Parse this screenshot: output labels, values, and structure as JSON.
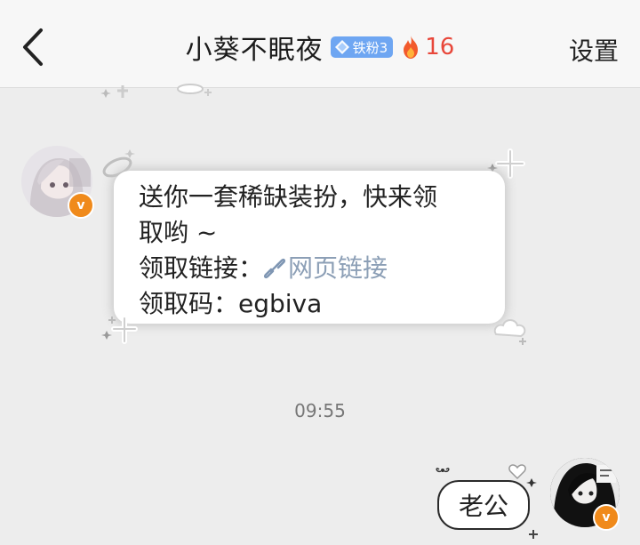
{
  "header": {
    "title": "小葵不眠夜",
    "fan_badge": "铁粉3",
    "fire_count": "16",
    "settings_label": "设置"
  },
  "messages": {
    "incoming": {
      "line1": "送你一套稀缺装扮，快来领",
      "line2": "取哟 ~",
      "link_prefix": "领取链接：",
      "link_text": "网页链接",
      "code_line": "领取码：egbiva"
    },
    "timestamp": "09:55",
    "outgoing": {
      "text": "老公"
    }
  },
  "icons": {
    "back": "chevron-left-icon",
    "badge_diamond": "diamond-icon",
    "fire": "fire-icon",
    "link": "link-icon",
    "verified": "verified-v-icon"
  },
  "colors": {
    "background": "#ededed",
    "badge_blue": "#6ea6f2",
    "fire_red": "#e8473a",
    "verified_orange": "#f08a1b",
    "link_gray_blue": "#8c9fb6"
  }
}
